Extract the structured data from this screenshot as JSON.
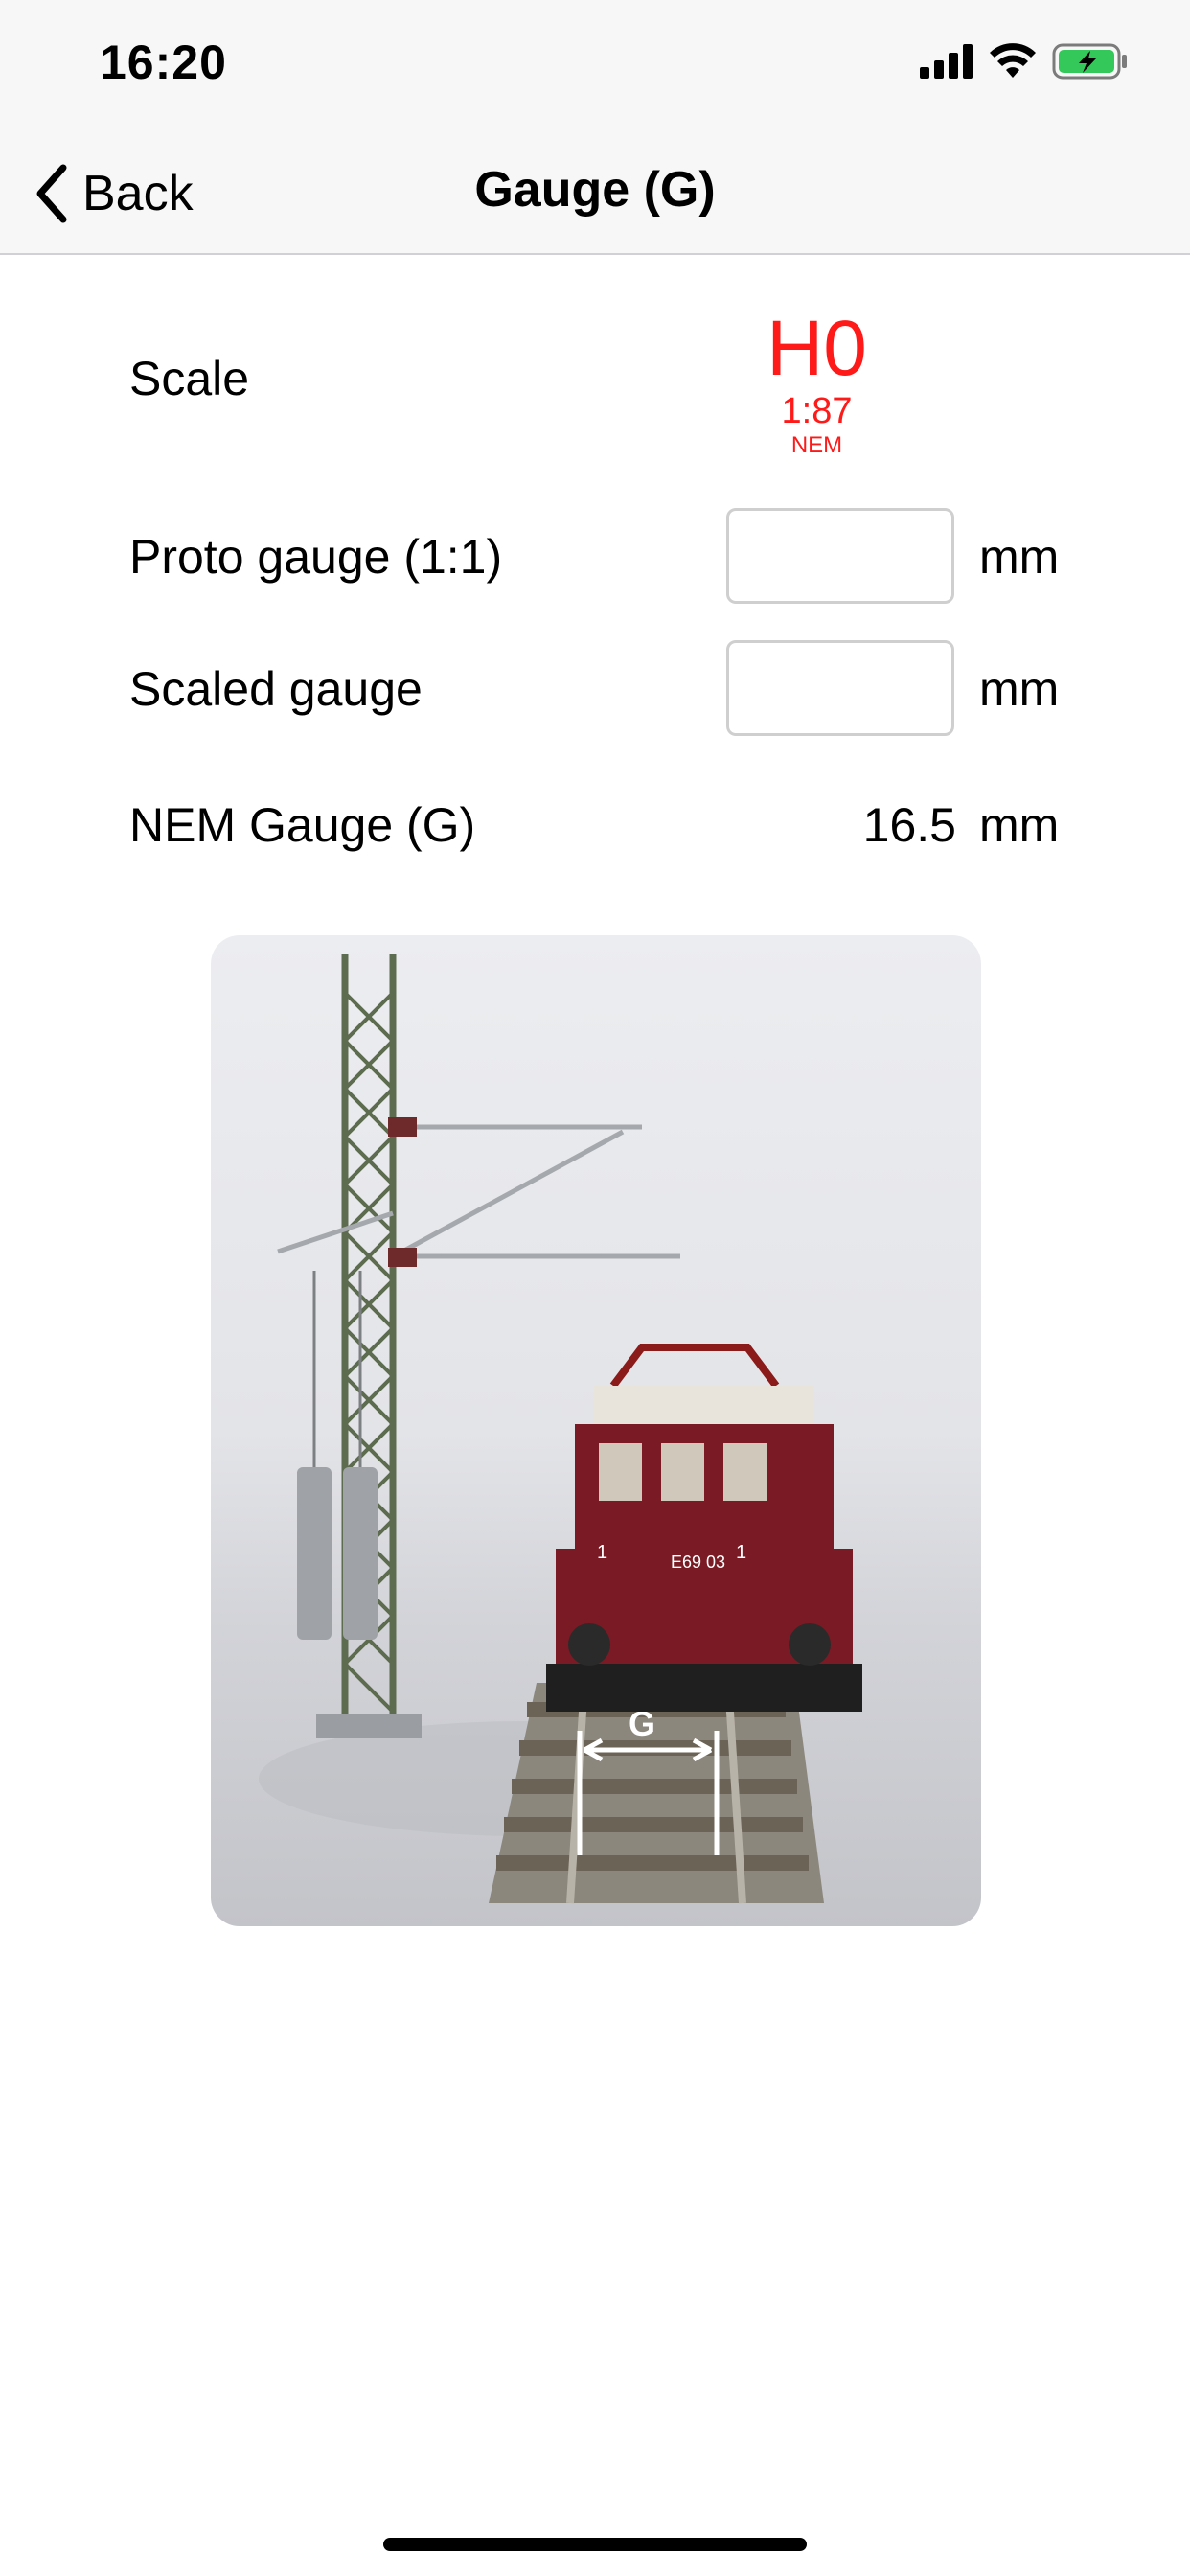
{
  "status": {
    "time": "16:20"
  },
  "nav": {
    "back_label": "Back",
    "title": "Gauge (G)"
  },
  "scale": {
    "label": "Scale",
    "name": "H0",
    "ratio": "1:87",
    "standard": "NEM"
  },
  "proto_gauge": {
    "label": "Proto gauge (1:1)",
    "value": "",
    "unit": "mm"
  },
  "scaled_gauge": {
    "label": "Scaled gauge",
    "value": "",
    "unit": "mm"
  },
  "nem_gauge": {
    "label": "NEM Gauge (G)",
    "value": "16.5",
    "unit": "mm"
  },
  "illustration": {
    "locomotive_number": "E69 03",
    "side_number": "1",
    "gauge_marker": "G"
  },
  "colors": {
    "accent": "#ff1a1a",
    "loco_body": "#7a1a24",
    "mast": "#5d6b4f",
    "battery": "#34c759"
  }
}
